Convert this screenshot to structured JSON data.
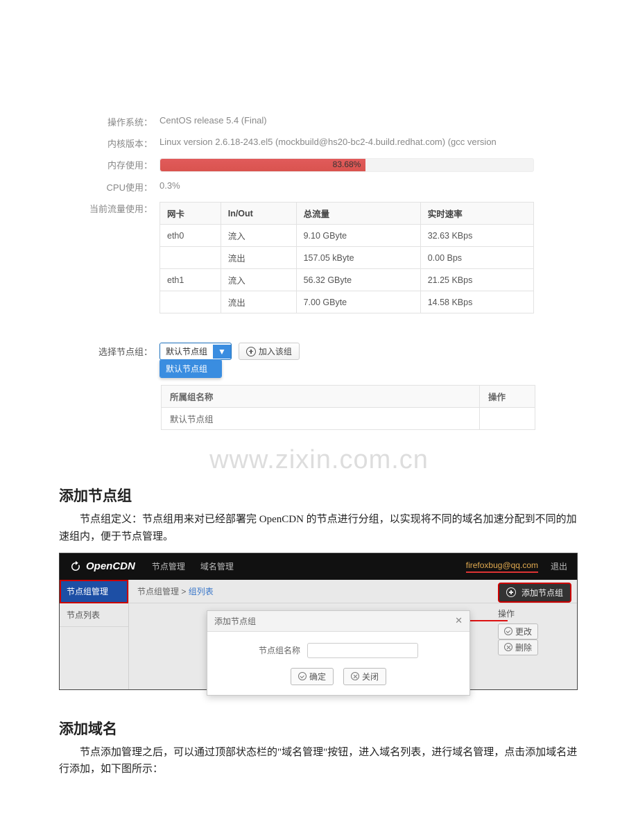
{
  "sysinfo": {
    "labels": {
      "os": "操作系统：",
      "kernel": "内核版本：",
      "mem": "内存使用：",
      "cpu": "CPU使用：",
      "traffic": "当前流量使用："
    },
    "os": "CentOS release 5.4 (Final)",
    "kernel": "Linux version 2.6.18-243.el5 (mockbuild@hs20-bc2-4.build.redhat.com) (gcc version",
    "mem_pct_text": "83.68%",
    "mem_pct_num": 55,
    "cpu_text": "0.3%"
  },
  "traffic": {
    "headers": [
      "网卡",
      "In/Out",
      "总流量",
      "实时速率"
    ],
    "rows": [
      [
        "eth0",
        "流入",
        "9.10 GByte",
        "32.63 KBps"
      ],
      [
        "",
        "流出",
        "157.05 kByte",
        "0.00 Bps"
      ],
      [
        "eth1",
        "流入",
        "56.32 GByte",
        "21.25 KBps"
      ],
      [
        "",
        "流出",
        "7.00 GByte",
        "14.58 KBps"
      ]
    ]
  },
  "ng": {
    "label": "选择节点组：",
    "selected": "默认节点组",
    "options": [
      "默认节点组"
    ],
    "join_btn": "加入该组",
    "table": {
      "headers": [
        "所属组名称",
        "操作"
      ],
      "rows": [
        [
          "默认节点组",
          ""
        ]
      ]
    }
  },
  "watermark": "www.zixin.com.cn",
  "doc": {
    "h_add_group": "添加节点组",
    "p_add_group": "节点组定义：节点组用来对已经部署完 OpenCDN 的节点进行分组，以实现将不同的域名加速分配到不同的加速组内，便于节点管理。",
    "h_add_domain": "添加域名",
    "p_add_domain": "节点添加管理之后，可以通过顶部状态栏的\"域名管理\"按钮，进入域名列表，进行域名管理，点击添加域名进行添加，如下图所示："
  },
  "app": {
    "brand": "OpenCDN",
    "nav": [
      "节点管理",
      "域名管理"
    ],
    "user": "firefoxbug@qq.com",
    "logout": "退出",
    "sidebar": {
      "active": "节点组管理",
      "items": [
        "节点列表"
      ]
    },
    "crumb_a": "节点组管理",
    "crumb_sep": " > ",
    "crumb_b": "组列表",
    "add_btn": "添加节点组",
    "ops_head": "操作",
    "op_edit": "更改",
    "op_del": "删除",
    "modal": {
      "title": "添加节点组",
      "field_label": "节点组名称",
      "ok": "确定",
      "close": "关闭"
    }
  }
}
